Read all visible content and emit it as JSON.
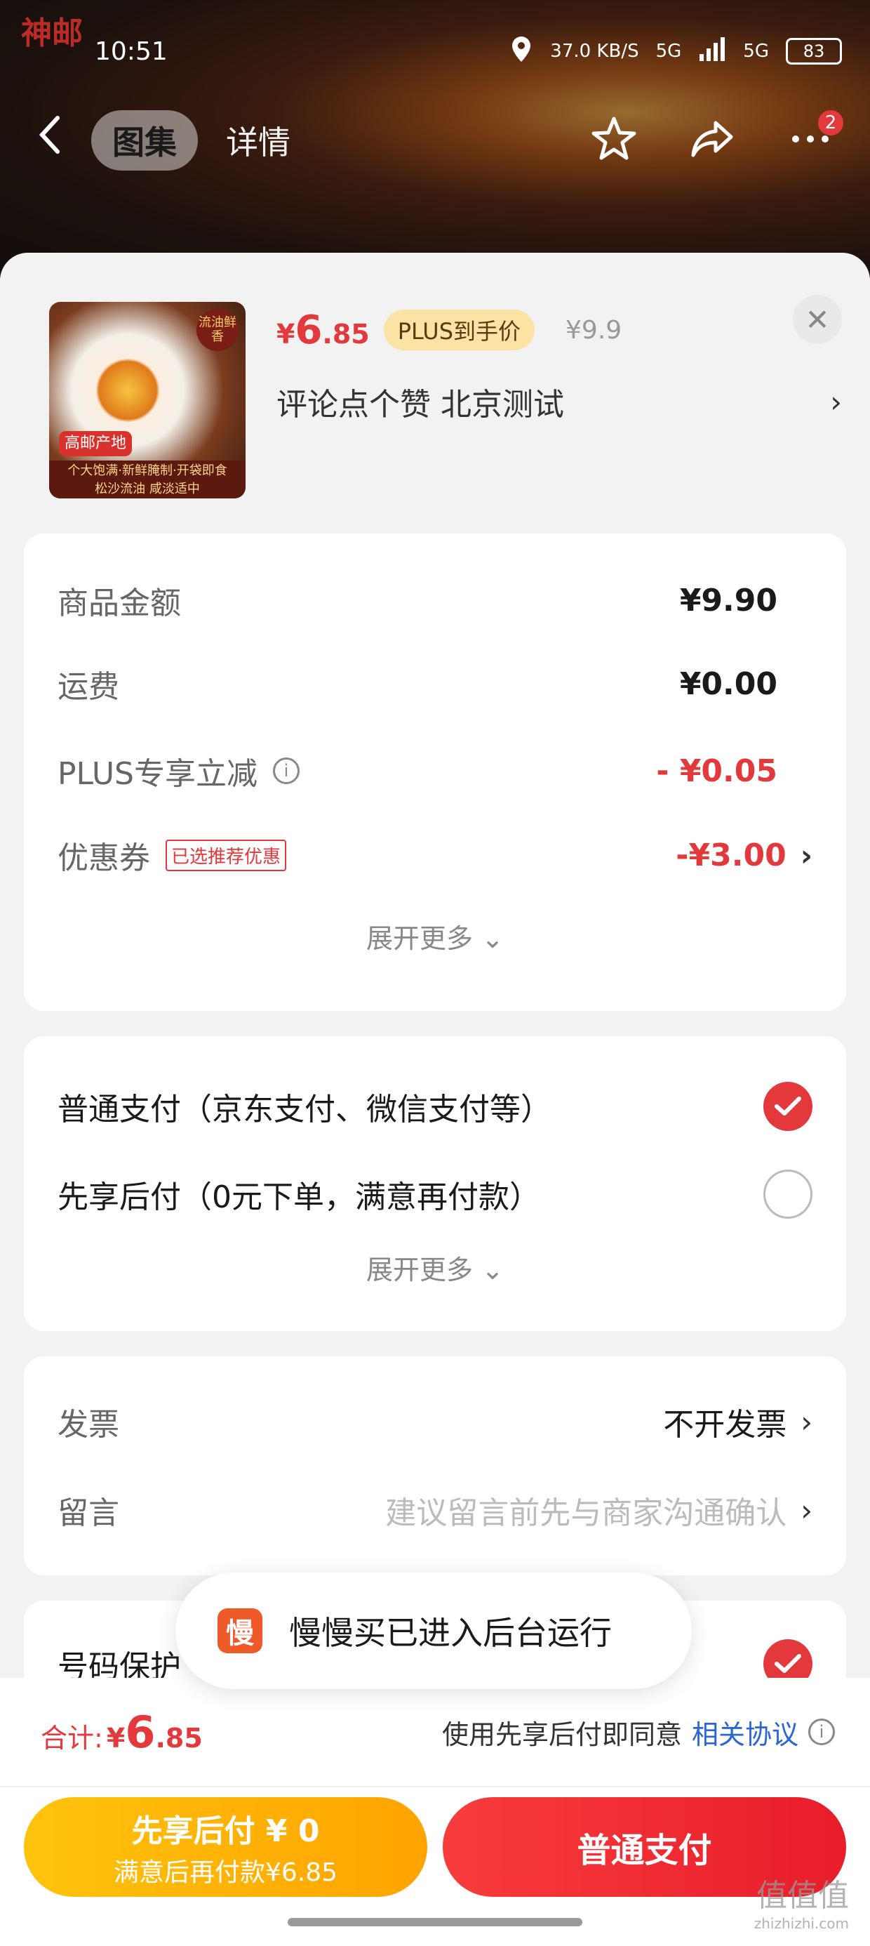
{
  "status": {
    "brand": "神邮",
    "time": "10:51",
    "net_speed": "37.0 KB/S",
    "signal1": "5G",
    "signal2": "5G",
    "battery": "83"
  },
  "nav": {
    "tabs": [
      "图集",
      "详情"
    ],
    "badge_count": "2"
  },
  "product": {
    "thumb": {
      "badge": "流油鲜香",
      "tag": "高邮产地",
      "strip_line1": "个大饱满·新鲜腌制·开袋即食",
      "strip_line2": "松沙流油 咸淡适中"
    },
    "price_currency": "¥",
    "price_int": "6",
    "price_dec": ".85",
    "plus_tag": "PLUS到手价",
    "original_price": "¥9.9",
    "subtitle": "评论点个赞  北京测试"
  },
  "amounts": {
    "goods_label": "商品金额",
    "goods_value": "¥9.90",
    "shipping_label": "运费",
    "shipping_value": "¥0.00",
    "plus_label": "PLUS专享立减",
    "plus_value": "- ¥0.05",
    "coupon_label": "优惠券",
    "coupon_tag": "已选推荐优惠",
    "coupon_value": "-¥3.00",
    "expand": "展开更多"
  },
  "payment": {
    "option1": "普通支付（京东支付、微信支付等）",
    "option2": "先享后付（0元下单，满意再付款）",
    "selected": "option1",
    "expand": "展开更多"
  },
  "extras": {
    "invoice_label": "发票",
    "invoice_value": "不开发票",
    "message_label": "留言",
    "message_placeholder": "建议留言前先与商家沟通确认",
    "number_protect_label": "号码保护"
  },
  "toast": {
    "icon_char": "慢",
    "text": "慢慢买已进入后台运行"
  },
  "footer": {
    "total_label": "合计:",
    "total_currency": "¥",
    "total_int": "6",
    "total_dec": ".85",
    "agree_text": "使用先享后付即同意",
    "agree_link": "相关协议",
    "btn_bnpl_line1": "先享后付 ¥ 0",
    "btn_bnpl_line2": "满意后再付款¥6.85",
    "btn_pay": "普通支付"
  },
  "watermark": {
    "main": "值值值",
    "url": "zhizhizhi.com"
  },
  "colors": {
    "accent_red": "#e4393c",
    "plus_gold": "#fbe3a6",
    "bnpl_yellow": "#ffb400",
    "link_blue": "#2a66d6"
  }
}
